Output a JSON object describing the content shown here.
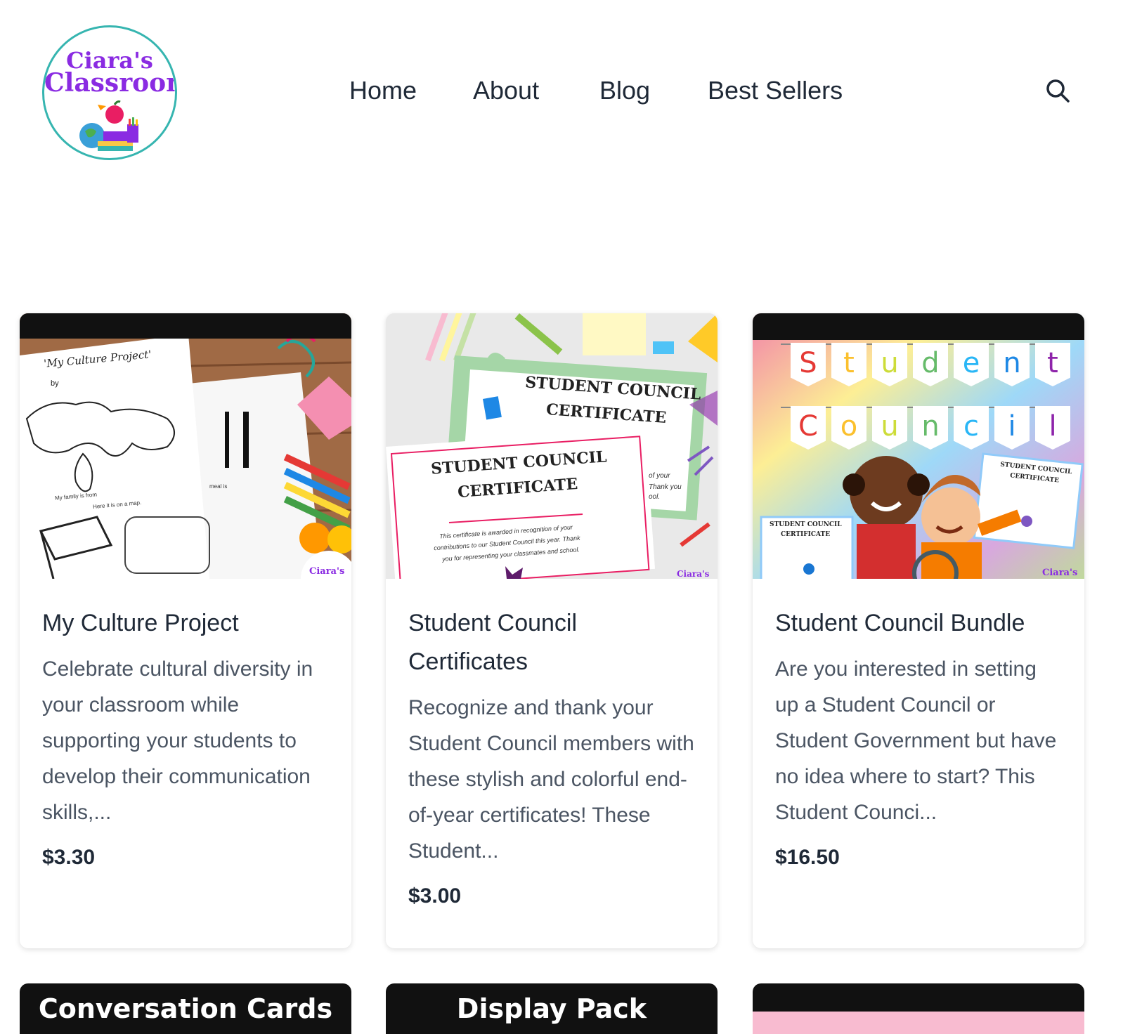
{
  "brand": {
    "logo_line1": "Ciara's",
    "logo_line2": "Classroom"
  },
  "nav": {
    "items": [
      {
        "label": "Home"
      },
      {
        "label": "About"
      },
      {
        "label": "Blog"
      },
      {
        "label": "Best Sellers"
      }
    ],
    "search_icon": "search-icon"
  },
  "products": [
    {
      "title": "My Culture Project",
      "description": "Celebrate cultural diversity in your classroom while supporting your students to develop their communication skills,...",
      "price": "$3.30",
      "thumb": {
        "sheet_title": "'My Culture Project'",
        "sheet_by": "by",
        "sheet_caption1": "My family is from",
        "sheet_caption2": "Here it is on a map.",
        "sheet_caption3": "meal is",
        "watermark": "Ciara's"
      }
    },
    {
      "title": "Student Council Certificates",
      "description": "Recognize and thank your Student Council members with these stylish and colorful end-of-year certificates! These Student...",
      "price": "$3.00",
      "thumb": {
        "back_heading_line1": "STUDENT COUNCIL",
        "back_heading_line2": "CERTIFICATE",
        "front_heading_line1": "STUDENT COUNCIL",
        "front_heading_line2": "CERTIFICATE",
        "body_line1": "This certificate is awarded in recognition of your",
        "body_line2": "contributions to our Student Council this year. Thank",
        "body_line3": "you for representing your classmates and school.",
        "side_text1": "of your",
        "side_text2": "Thank you",
        "side_text3": "ool.",
        "watermark": "Ciara's"
      }
    },
    {
      "title": "Student Council Bundle",
      "description": "Are you interested in setting up a Student Council or Student Government but have no idea where to start? This Student Counci...",
      "price": "$16.50",
      "thumb": {
        "banner_word1": [
          "S",
          "t",
          "u",
          "d",
          "e",
          "n",
          "t"
        ],
        "banner_word2": [
          "C",
          "o",
          "u",
          "n",
          "c",
          "i",
          "l"
        ],
        "mini_cert1_line1": "STUDENT COUNCIL",
        "mini_cert1_line2": "CERTIFICATE",
        "mini_cert2_line1": "STUDENT COUNCIL",
        "mini_cert2_line2": "CERTIFICATE",
        "watermark": "Ciara's"
      }
    }
  ],
  "partial_products": [
    {
      "thumb_title": "Conversation Cards"
    },
    {
      "thumb_title": "Display Pack"
    },
    {
      "thumb_title": ""
    }
  ],
  "colors": {
    "text_dark": "#1f2937",
    "text_body": "#4b5563",
    "logo_purple": "#8a2be2",
    "logo_ring": "#36b5b0"
  }
}
